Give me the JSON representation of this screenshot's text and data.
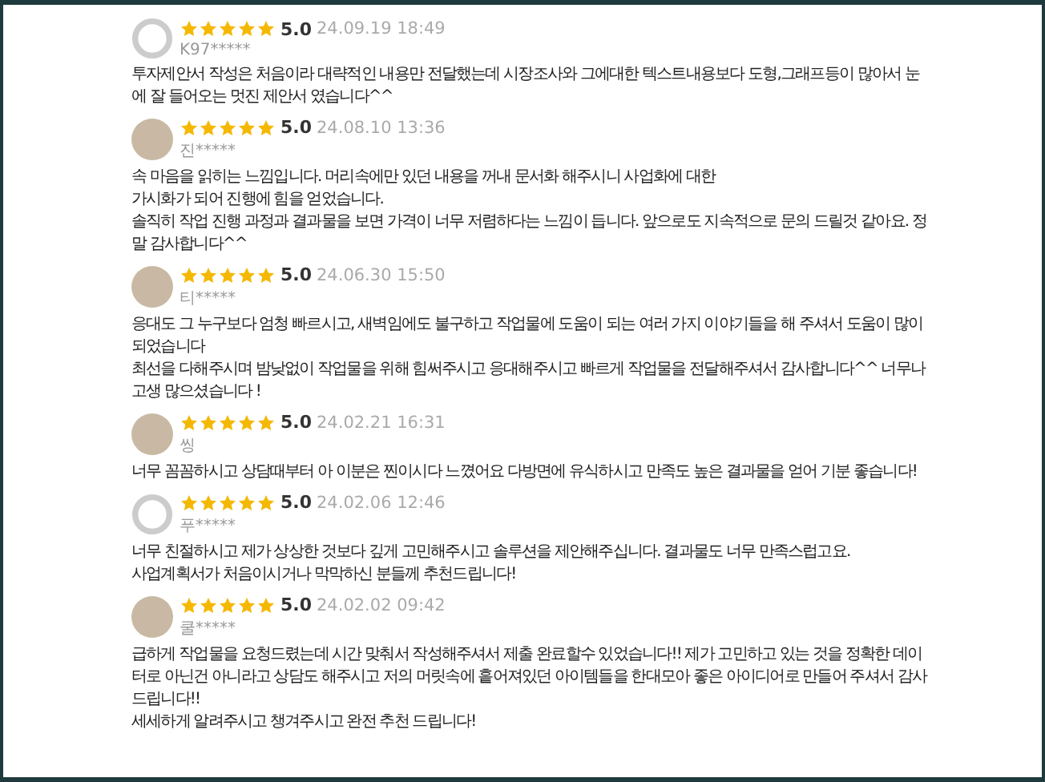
{
  "reviews": [
    {
      "kind": "default",
      "stars": 5,
      "score": "5.0",
      "date": "24.09.19 18:49",
      "user": "K97*****",
      "paragraphs": [
        "투자제안서 작성은 처음이라 대략적인 내용만 전달했는데 시장조사와 그에대한 텍스트내용보다 도형,그래프등이 많아서 눈에 잘 들어오는 멋진 제안서 였습니다^^"
      ]
    },
    {
      "kind": "photo",
      "stars": 5,
      "score": "5.0",
      "date": "24.08.10 13:36",
      "user": "진*****",
      "paragraphs": [
        "속 마음을 읽히는 느낌입니다. 머리속에만 있던 내용을 꺼내 문서화 해주시니 사업화에 대한",
        "가시화가 되어 진행에 힘을 얻었습니다.",
        "솔직히 작업 진행 과정과 결과물을 보면 가격이 너무 저렴하다는 느낌이 듭니다. 앞으로도 지속적으로 문의 드릴것 같아요. 정말 감사합니다^^"
      ]
    },
    {
      "kind": "photo",
      "stars": 5,
      "score": "5.0",
      "date": "24.06.30 15:50",
      "user": "티*****",
      "paragraphs": [
        "응대도 그 누구보다 엄청 빠르시고, 새벽임에도 불구하고 작업물에 도움이 되는 여러 가지 이야기들을 해 주셔서 도움이 많이 되었습니다",
        "최선을 다해주시며 밤낮없이 작업물을 위해 힘써주시고  응대해주시고 빠르게 작업물을 전달해주셔서  감사합니다^^ 너무나 고생 많으셨습니다 !"
      ]
    },
    {
      "kind": "photo",
      "stars": 5,
      "score": "5.0",
      "date": "24.02.21 16:31",
      "user": "씽",
      "paragraphs": [
        "너무 꼼꼼하시고 상담때부터 아 이분은 찐이시다 느꼈어요 다방면에 유식하시고 만족도 높은 결과물을 얻어 기분 좋습니다!"
      ]
    },
    {
      "kind": "default",
      "stars": 5,
      "score": "5.0",
      "date": "24.02.06 12:46",
      "user": "푸*****",
      "paragraphs": [
        "너무 친절하시고 제가 상상한 것보다 깊게 고민해주시고 솔루션을 제안해주십니다. 결과물도 너무 만족스럽고요.",
        "사업계획서가 처음이시거나 막막하신 분들께 추천드립니다!"
      ]
    },
    {
      "kind": "photo",
      "stars": 5,
      "score": "5.0",
      "date": "24.02.02 09:42",
      "user": "쿨*****",
      "paragraphs": [
        "급하게 작업물을 요청드렸는데 시간 맞춰서 작성해주셔서 제출 완료할수 있었습니다!! 제가 고민하고 있는 것을 정확한 데이터로 아닌건 아니라고 상담도 해주시고 저의 머릿속에 흩어져있던 아이템들을 한대모아 좋은 아이디어로 만들어 주셔서 감사드립니다!!",
        "세세하게 알려주시고 챙겨주시고 완전 추천 드립니다!"
      ]
    }
  ]
}
